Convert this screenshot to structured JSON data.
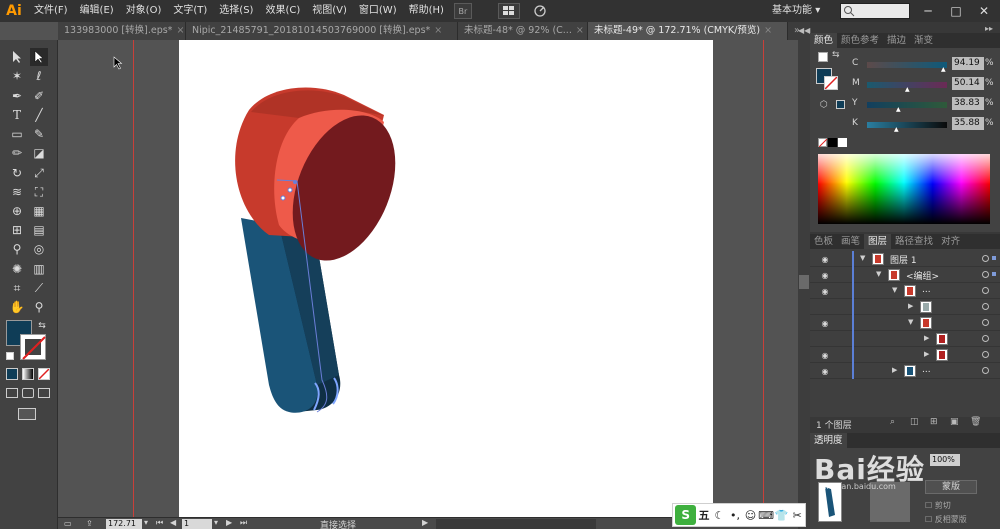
{
  "app": {
    "logo": "Ai",
    "menus": [
      "文件(F)",
      "编辑(E)",
      "对象(O)",
      "文字(T)",
      "选择(S)",
      "效果(C)",
      "视图(V)",
      "窗口(W)",
      "帮助(H)"
    ],
    "bridge_label": "Br",
    "workspace": "基本功能",
    "workspace_caret": "▾",
    "window_controls": {
      "minimize": "─",
      "restore": "□",
      "close": "✕"
    }
  },
  "tabs": [
    {
      "label": "133983000 [转换].eps*",
      "active": false
    },
    {
      "label": "Nipic_21485791_20181014503769000 [转换].eps*",
      "active": false
    },
    {
      "label": "未标题-48* @ 92% (C...",
      "active": false
    },
    {
      "label": "未标题-49* @ 172.71% (CMYK/预览)",
      "active": true
    }
  ],
  "tab_close": "×",
  "tab_overflow": "»",
  "color_panel": {
    "tabs": [
      "颜色",
      "颜色参考",
      "描边",
      "渐变"
    ],
    "channels": [
      {
        "label": "C",
        "value": "94.19",
        "unit": "%"
      },
      {
        "label": "M",
        "value": "50.14",
        "unit": "%"
      },
      {
        "label": "Y",
        "value": "38.83",
        "unit": "%"
      },
      {
        "label": "K",
        "value": "35.88",
        "unit": "%"
      }
    ],
    "fill_color": "#0f3d57"
  },
  "layers_panel": {
    "tabs": [
      "色板",
      "画笔",
      "图层",
      "路径查找",
      "对齐"
    ],
    "rows": [
      {
        "name": "图层 1",
        "indent": 0,
        "expanded": true
      },
      {
        "name": "<编组>",
        "indent": 1,
        "expanded": true
      },
      {
        "name": "...",
        "indent": 2,
        "expanded": true
      },
      {
        "name": "",
        "indent": 3,
        "expanded": false
      },
      {
        "name": "",
        "indent": 3,
        "expanded": true
      },
      {
        "name": "",
        "indent": 4,
        "expanded": false
      },
      {
        "name": "",
        "indent": 4,
        "expanded": false
      },
      {
        "name": "...",
        "indent": 2,
        "expanded": false
      }
    ],
    "footer": "1 个图层"
  },
  "lower_panel": {
    "tab": "透明度",
    "opacity": "100%",
    "mask_button": "蒙版",
    "clip_label": "剪切",
    "invert_label": "反相蒙版"
  },
  "statusbar": {
    "zoom": "172.71",
    "artboard": "1",
    "tool": "直接选择"
  },
  "ime": {
    "logo": "S",
    "label": "五"
  },
  "watermark": {
    "text": "Bai经验",
    "sub": "jingyan.baidu.com"
  }
}
